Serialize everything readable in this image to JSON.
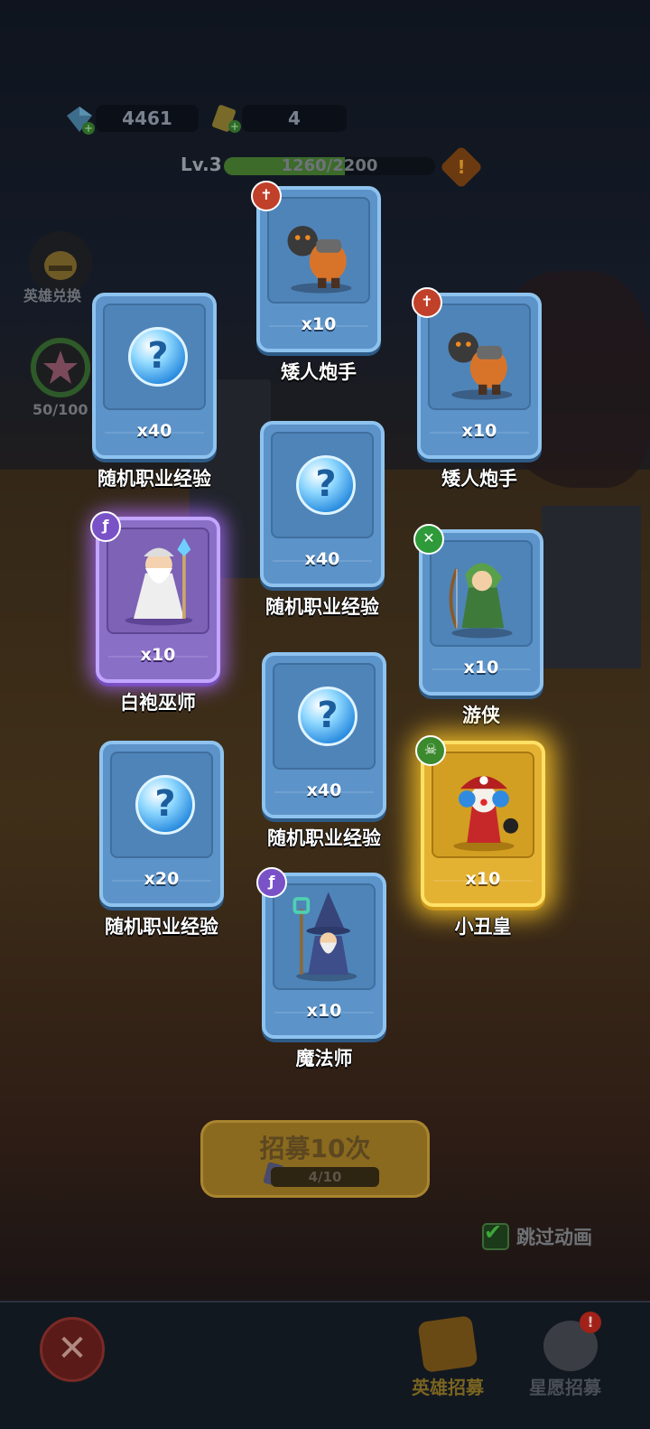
{
  "hud": {
    "gems": "4461",
    "tickets": "4",
    "level": "Lv.3",
    "xp": "1260/2200",
    "xp_fraction": 0.573,
    "warning_glyph": "!"
  },
  "side": {
    "hero_exchange_label": "英雄兑换",
    "wish_progress_label": "50/100"
  },
  "cards": [
    {
      "qty": "x10",
      "name": "矮人炮手",
      "rarity": "blue",
      "class_icon": "sword-icon",
      "art": "dwarf-gunner"
    },
    {
      "qty": "x40",
      "name": "随机职业经验",
      "rarity": "blue",
      "class_icon": "",
      "art": "exp-orb"
    },
    {
      "qty": "x10",
      "name": "矮人炮手",
      "rarity": "blue",
      "class_icon": "sword-icon",
      "art": "dwarf-gunner"
    },
    {
      "qty": "x40",
      "name": "随机职业经验",
      "rarity": "blue",
      "class_icon": "",
      "art": "exp-orb"
    },
    {
      "qty": "x10",
      "name": "白袍巫师",
      "rarity": "purple",
      "class_icon": "staff-icon",
      "art": "white-wizard"
    },
    {
      "qty": "x10",
      "name": "游侠",
      "rarity": "blue",
      "class_icon": "bow-icon",
      "art": "ranger"
    },
    {
      "qty": "x40",
      "name": "随机职业经验",
      "rarity": "blue",
      "class_icon": "",
      "art": "exp-orb"
    },
    {
      "qty": "x20",
      "name": "随机职业经验",
      "rarity": "blue",
      "class_icon": "",
      "art": "exp-orb"
    },
    {
      "qty": "x10",
      "name": "小丑皇",
      "rarity": "gold",
      "class_icon": "skull-icon",
      "art": "clown-king"
    },
    {
      "qty": "x10",
      "name": "魔法师",
      "rarity": "blue",
      "class_icon": "staff-icon",
      "art": "mage"
    }
  ],
  "orb_glyph": "?",
  "badge_glyphs": {
    "sword-icon": "✝",
    "staff-icon": "ƒ",
    "bow-icon": "✕",
    "skull-icon": "☠"
  },
  "recruit": {
    "label": "招募10次",
    "progress": "4/10"
  },
  "skip": {
    "checked": true,
    "check_glyph": "✔",
    "label": "跳过动画"
  },
  "bottom_tabs": {
    "close_glyph": "✕",
    "hero_recruit": "英雄招募",
    "star_wish": "星愿招募",
    "notice_glyph": "!"
  },
  "colors": {
    "blue_card": "#5c93c9",
    "purple_card": "#8a6fc7",
    "gold_card": "#e4b232"
  }
}
